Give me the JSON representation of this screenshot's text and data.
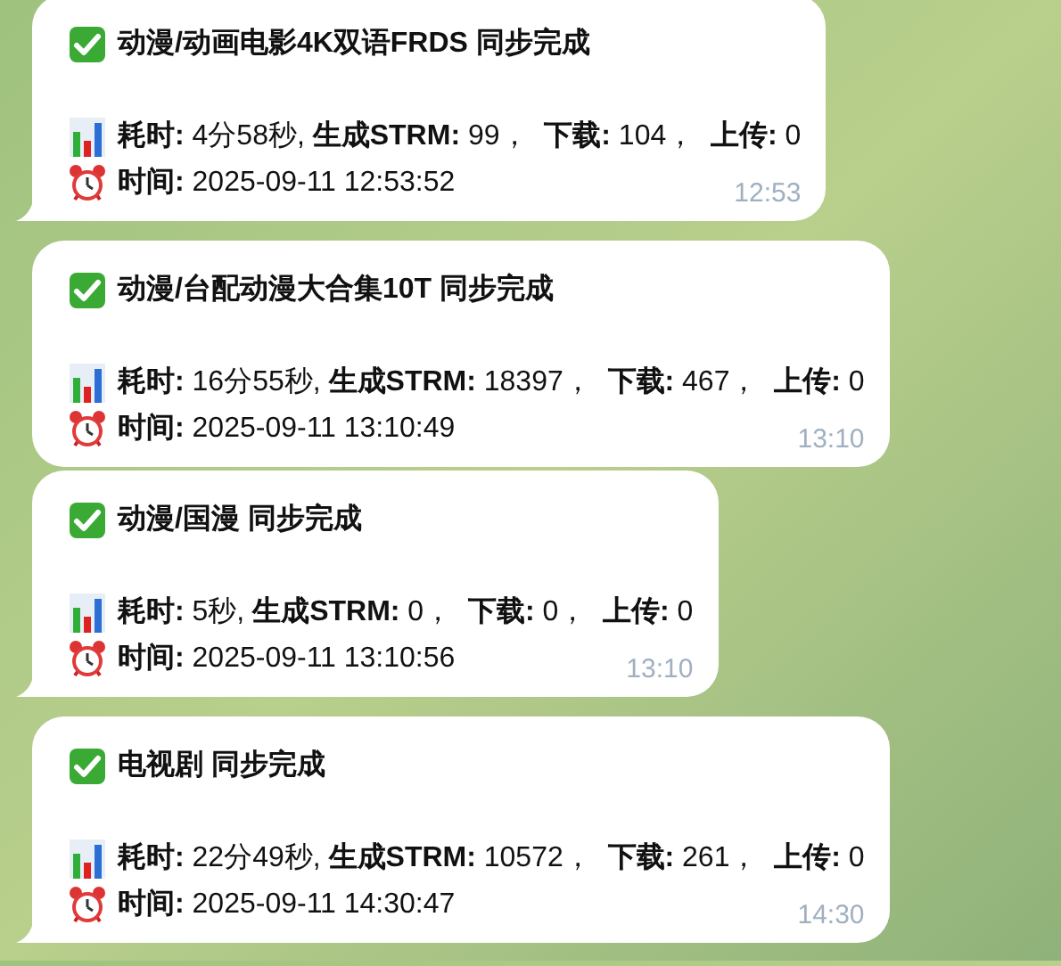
{
  "messages": [
    {
      "title": "动漫/动画电影4K双语FRDS 同步完成",
      "stats": "**耗时:** 4分58秒, **生成STRM:** 99，  **下载:** 104，  **上传:** 0",
      "time_line": "**时间:** 2025-09-11 12:53:52",
      "timestamp": "12:53",
      "tail": true
    },
    {
      "title": "动漫/台配动漫大合集10T 同步完成",
      "stats": "**耗时:** 16分55秒, **生成STRM:** 18397，  **下载:** 467，  **上传:** 0",
      "time_line": "**时间:** 2025-09-11 13:10:49",
      "timestamp": "13:10",
      "tail": false
    },
    {
      "title": "动漫/国漫 同步完成",
      "stats": "**耗时:** 5秒, **生成STRM:** 0，  **下载:** 0，  **上传:** 0",
      "time_line": "**时间:** 2025-09-11 13:10:56",
      "timestamp": "13:10",
      "tail": true
    },
    {
      "title": "电视剧 同步完成",
      "stats": "**耗时:** 22分49秒, **生成STRM:** 10572，  **下载:** 261，  **上传:** 0",
      "time_line": "**时间:** 2025-09-11 14:30:47",
      "timestamp": "14:30",
      "tail": true
    }
  ]
}
